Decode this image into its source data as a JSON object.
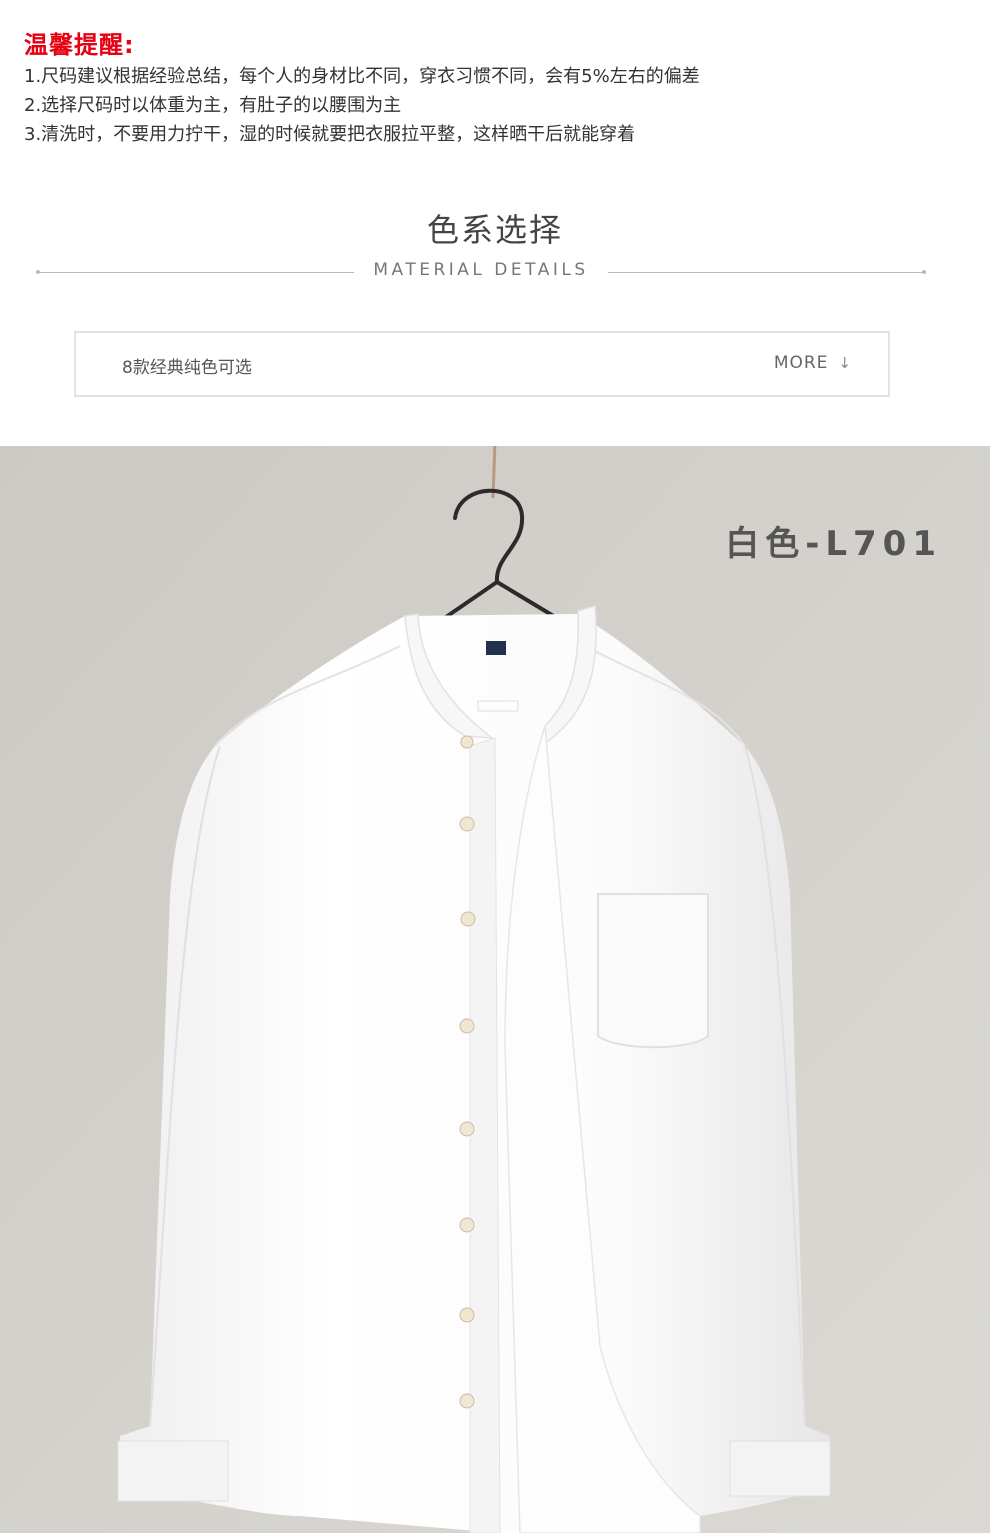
{
  "tips": {
    "title": "温馨提醒:",
    "lines": [
      "1.尺码建议根据经验总结，每个人的身材比不同，穿衣习惯不同，会有5%左右的偏差",
      "2.选择尺码时以体重为主，有肚子的以腰围为主",
      "3.清洗时，不要用力拧干，湿的时候就要把衣服拉平整，这样晒干后就能穿着"
    ]
  },
  "section": {
    "title": "色系选择",
    "subtitle": "MATERIAL DETAILS"
  },
  "more_bar": {
    "text": "8款经典纯色可选",
    "more_label": "MORE",
    "arrow": "↓"
  },
  "product": {
    "color_label": "白色-L701"
  },
  "colors": {
    "tip_red": "#e60012",
    "background_wall": "#d5d2cd",
    "shirt": "#fafafa"
  },
  "icons": [
    "arrow-down-icon",
    "hanger-icon"
  ]
}
